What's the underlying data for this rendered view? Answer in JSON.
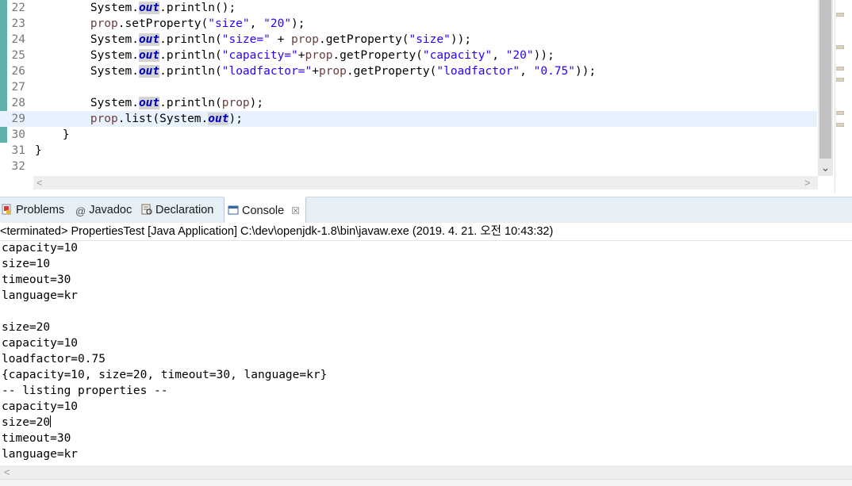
{
  "editor": {
    "lines": [
      {
        "num": "22",
        "segments": [
          {
            "t": "        System.",
            "c": ""
          },
          {
            "t": "out",
            "c": "kw-field"
          },
          {
            "t": ".println();",
            "c": ""
          }
        ]
      },
      {
        "num": "23",
        "segments": [
          {
            "t": "        ",
            "c": ""
          },
          {
            "t": "prop",
            "c": "var"
          },
          {
            "t": ".setProperty(",
            "c": ""
          },
          {
            "t": "\"size\"",
            "c": "str"
          },
          {
            "t": ", ",
            "c": ""
          },
          {
            "t": "\"20\"",
            "c": "str"
          },
          {
            "t": ");",
            "c": ""
          }
        ]
      },
      {
        "num": "24",
        "segments": [
          {
            "t": "        System.",
            "c": ""
          },
          {
            "t": "out",
            "c": "kw-field"
          },
          {
            "t": ".println(",
            "c": ""
          },
          {
            "t": "\"size=\"",
            "c": "str"
          },
          {
            "t": " + ",
            "c": ""
          },
          {
            "t": "prop",
            "c": "var"
          },
          {
            "t": ".getProperty(",
            "c": ""
          },
          {
            "t": "\"size\"",
            "c": "str"
          },
          {
            "t": "));",
            "c": ""
          }
        ]
      },
      {
        "num": "25",
        "segments": [
          {
            "t": "        System.",
            "c": ""
          },
          {
            "t": "out",
            "c": "kw-field"
          },
          {
            "t": ".println(",
            "c": ""
          },
          {
            "t": "\"capacity=\"",
            "c": "str"
          },
          {
            "t": "+",
            "c": ""
          },
          {
            "t": "prop",
            "c": "var"
          },
          {
            "t": ".getProperty(",
            "c": ""
          },
          {
            "t": "\"capacity\"",
            "c": "str"
          },
          {
            "t": ", ",
            "c": ""
          },
          {
            "t": "\"20\"",
            "c": "str"
          },
          {
            "t": "));",
            "c": ""
          }
        ]
      },
      {
        "num": "26",
        "segments": [
          {
            "t": "        System.",
            "c": ""
          },
          {
            "t": "out",
            "c": "kw-field"
          },
          {
            "t": ".println(",
            "c": ""
          },
          {
            "t": "\"loadfactor=\"",
            "c": "str"
          },
          {
            "t": "+",
            "c": ""
          },
          {
            "t": "prop",
            "c": "var"
          },
          {
            "t": ".getProperty(",
            "c": ""
          },
          {
            "t": "\"loadfactor\"",
            "c": "str"
          },
          {
            "t": ", ",
            "c": ""
          },
          {
            "t": "\"0.75\"",
            "c": "str"
          },
          {
            "t": "));",
            "c": ""
          }
        ]
      },
      {
        "num": "27",
        "segments": []
      },
      {
        "num": "28",
        "segments": [
          {
            "t": "        System.",
            "c": ""
          },
          {
            "t": "out",
            "c": "kw-field"
          },
          {
            "t": ".println(",
            "c": ""
          },
          {
            "t": "prop",
            "c": "var"
          },
          {
            "t": ");",
            "c": ""
          }
        ]
      },
      {
        "num": "29",
        "current": true,
        "segments": [
          {
            "t": "        ",
            "c": ""
          },
          {
            "t": "prop",
            "c": "var"
          },
          {
            "t": ".list(System.",
            "c": ""
          },
          {
            "t": "out",
            "c": "kw-field"
          },
          {
            "t": ");",
            "c": ""
          }
        ]
      },
      {
        "num": "30",
        "segments": [
          {
            "t": "    }",
            "c": ""
          }
        ]
      },
      {
        "num": "31",
        "segments": [
          {
            "t": "}",
            "c": ""
          }
        ]
      },
      {
        "num": "32",
        "segments": []
      }
    ]
  },
  "tabs": [
    {
      "label": "Problems",
      "icon": "problems-icon"
    },
    {
      "label": "Javadoc",
      "icon": "javadoc-icon"
    },
    {
      "label": "Declaration",
      "icon": "declaration-icon"
    },
    {
      "label": "Console",
      "icon": "console-icon",
      "active": true,
      "close": "☒"
    }
  ],
  "console": {
    "header": "<terminated> PropertiesTest [Java Application] C:\\dev\\openjdk-1.8\\bin\\javaw.exe (2019. 4. 21. 오전 10:43:32)",
    "output": [
      "capacity=10",
      "size=10",
      "timeout=30",
      "language=kr",
      "",
      "size=20",
      "capacity=10",
      "loadfactor=0.75",
      "{capacity=10, size=20, timeout=30, language=kr}",
      "-- listing properties --",
      "capacity=10",
      "size=20",
      "timeout=30",
      "language=kr"
    ],
    "caret_line": 11
  },
  "colors": {
    "accent": "#5fb0a8",
    "current_line": "#e8f2fe",
    "field": "#0000c0",
    "string": "#2a00ff",
    "variable": "#6a3e3e"
  }
}
